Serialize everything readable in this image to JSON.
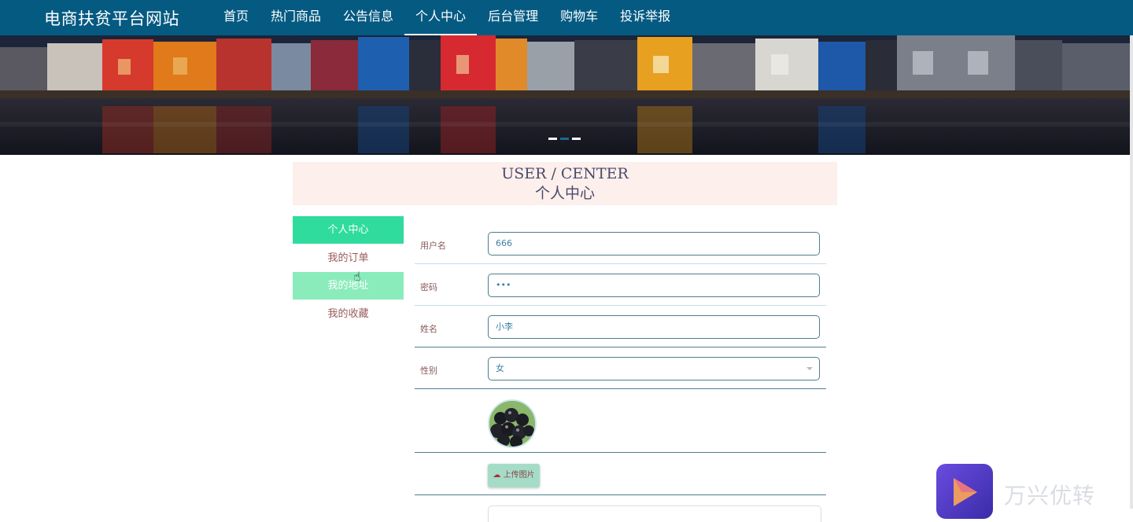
{
  "nav": {
    "brand": "电商扶贫平台网站",
    "items": [
      {
        "label": "首页"
      },
      {
        "label": "热门商品"
      },
      {
        "label": "公告信息"
      },
      {
        "label": "个人中心",
        "active": true
      },
      {
        "label": "后台管理"
      },
      {
        "label": "购物车"
      },
      {
        "label": "投诉举报"
      }
    ]
  },
  "banner": {
    "slides": 3,
    "active_slide": 2
  },
  "header": {
    "en": "USER / CENTER",
    "cn": "个人中心"
  },
  "sidebar": {
    "items": [
      {
        "label": "个人中心",
        "state": "active"
      },
      {
        "label": "我的订单",
        "state": "normal"
      },
      {
        "label": "我的地址",
        "state": "hover"
      },
      {
        "label": "我的收藏",
        "state": "normal"
      }
    ]
  },
  "form": {
    "username": {
      "label": "用户名",
      "value": "666"
    },
    "password": {
      "label": "密码",
      "value": "•••"
    },
    "name": {
      "label": "姓名",
      "value": "小李"
    },
    "gender": {
      "label": "性别",
      "value": "女"
    },
    "upload_label": "上传图片"
  },
  "watermark": {
    "text": "万兴优转"
  },
  "colors": {
    "nav_bg": "#055a82",
    "active_green": "#2fdc9e",
    "hover_green": "#8aecbb",
    "header_bg": "#fcefec",
    "upload_btn": "#a5dcc8"
  }
}
